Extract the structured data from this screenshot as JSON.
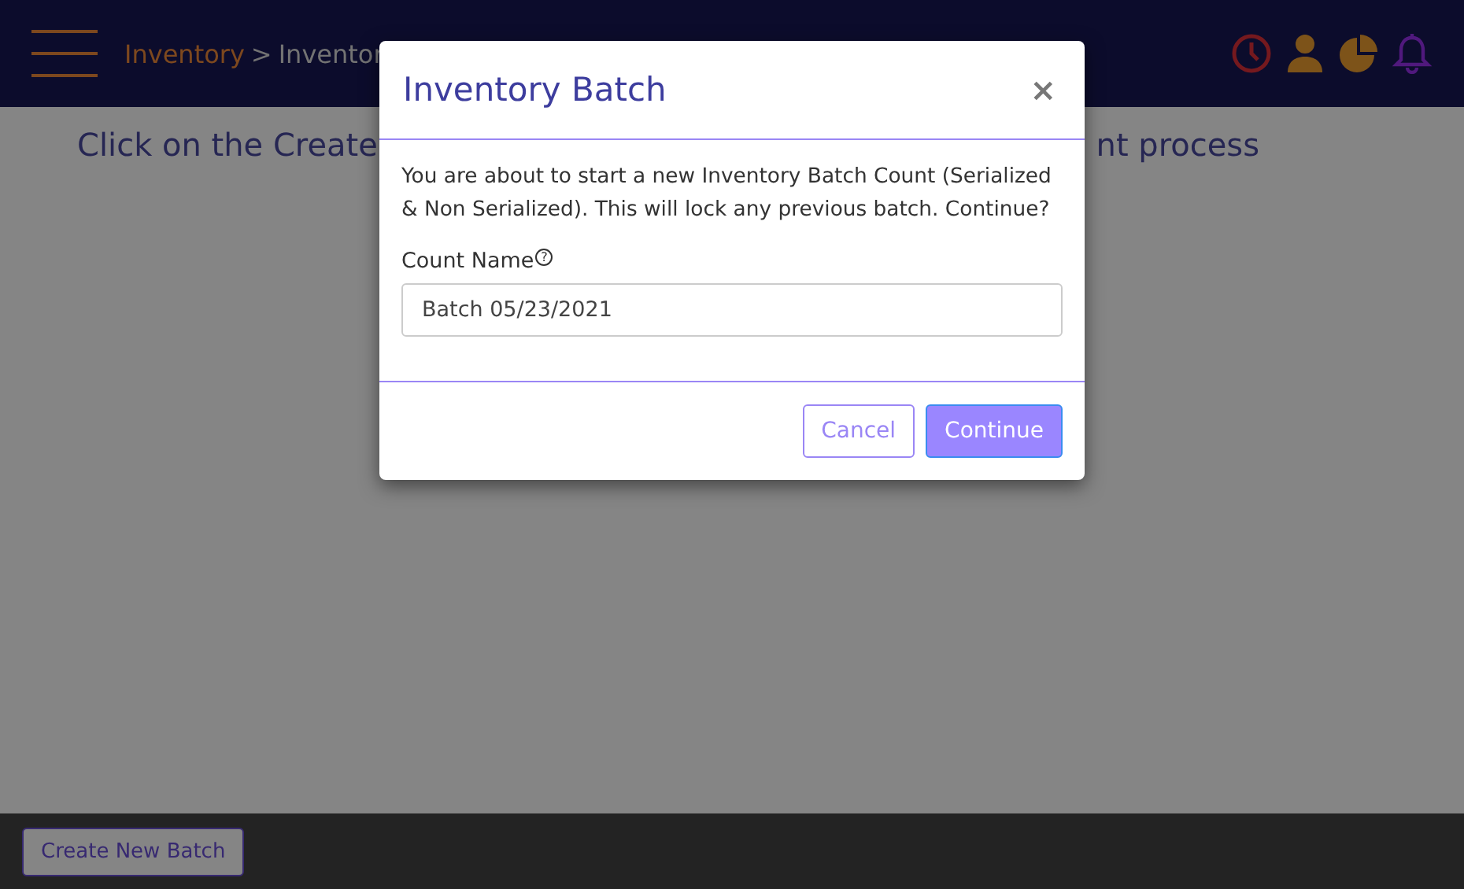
{
  "header": {
    "breadcrumb": [
      {
        "label": "Inventory",
        "kind": "link"
      },
      {
        "label": ">",
        "kind": "separator"
      },
      {
        "label": "Inventor",
        "kind": "current"
      }
    ]
  },
  "page": {
    "instruction_visible_parts": [
      "Click on the Create",
      "nt process"
    ]
  },
  "footer": {
    "button": "Create New Batch"
  },
  "dialog": {
    "title": "Inventory Batch",
    "close": "×",
    "message": "You are about to start a new Inventory Batch Count (Serialized & Non Serialized). This will lock any previous batch. Continue?",
    "field_label": "Count Name",
    "help_mark": "?",
    "field_value": "Batch 05/23/2021",
    "buttons": [
      {
        "label": "Cancel",
        "kind": "secondary"
      },
      {
        "label": "Continue",
        "kind": "primary"
      }
    ]
  }
}
